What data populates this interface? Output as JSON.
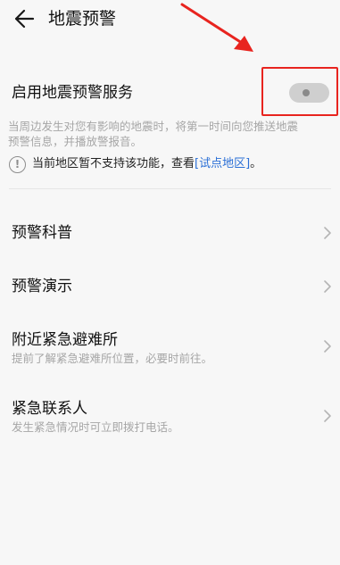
{
  "header": {
    "title": "地震预警"
  },
  "enable": {
    "label": "启用地震预警服务",
    "toggle_on": false,
    "description_line1": "当周边发生对您有影响的地震时，将第一时间向您推送地震",
    "description_line2": "预警信息，并播放警报音。"
  },
  "notice": {
    "text": "当前地区暂不支持该功能，查看",
    "link": "[试点地区]",
    "suffix": "。"
  },
  "items": [
    {
      "title": "预警科普",
      "subtitle": ""
    },
    {
      "title": "预警演示",
      "subtitle": ""
    },
    {
      "title": "附近紧急避难所",
      "subtitle": "提前了解紧急避难所位置，必要时前往。"
    },
    {
      "title": "紧急联系人",
      "subtitle": "发生紧急情况时可立即拨打电话。"
    }
  ],
  "colors": {
    "annotation": "#e8241f",
    "link": "#2a6fd6",
    "toggle_track": "#cfcfcf"
  }
}
